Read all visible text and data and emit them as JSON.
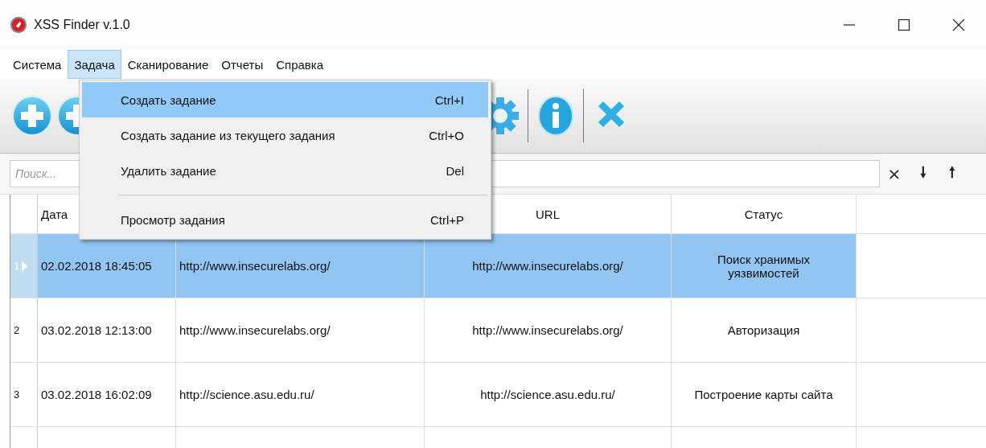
{
  "window": {
    "title": "XSS Finder v.1.0"
  },
  "menu_bar": [
    {
      "label": "Система",
      "selected": false
    },
    {
      "label": "Задача",
      "selected": true
    },
    {
      "label": "Сканирование",
      "selected": false
    },
    {
      "label": "Отчеты",
      "selected": false
    },
    {
      "label": "Справка",
      "selected": false
    }
  ],
  "dropdown": [
    {
      "kind": "item",
      "label": "Создать задание",
      "shortcut": "Ctrl+I",
      "selected": true
    },
    {
      "kind": "item",
      "label": "Создать задание из текущего задания",
      "shortcut": "Ctrl+O",
      "selected": false
    },
    {
      "kind": "item",
      "label": "Удалить задание",
      "shortcut": "Del",
      "selected": false
    },
    {
      "kind": "separator"
    },
    {
      "kind": "item",
      "label": "Просмотр задания",
      "shortcut": "Ctrl+P",
      "selected": false
    }
  ],
  "toolbar": [
    {
      "kind": "plus"
    },
    {
      "kind": "plus"
    },
    {
      "kind": "gear"
    },
    {
      "kind": "info"
    },
    {
      "kind": "delete"
    }
  ],
  "search": {
    "placeholder": "Поиск..."
  },
  "search_buttons": [
    {
      "kind": "clear",
      "label": "×"
    },
    {
      "kind": "down",
      "label": "🠗"
    },
    {
      "kind": "up",
      "label": "🠕"
    }
  ],
  "table": {
    "columns": [
      "Дата",
      "",
      "URL",
      "Статус"
    ],
    "rows": [
      {
        "number": "1",
        "selected": true,
        "cells": [
          "02.02.2018 18:45:05",
          "http://www.insecurelabs.org/",
          "http://www.insecurelabs.org/",
          "Поиск хранимых уязвимостей"
        ]
      },
      {
        "number": "2",
        "selected": false,
        "cells": [
          "03.02.2018 12:13:00",
          "http://www.insecurelabs.org/",
          "http://www.insecurelabs.org/",
          "Авторизация"
        ]
      },
      {
        "number": "3",
        "selected": false,
        "cells": [
          "03.02.2018 16:02:09",
          "http://science.asu.edu.ru/",
          "http://science.asu.edu.ru/",
          "Построение карты сайта"
        ]
      }
    ]
  }
}
